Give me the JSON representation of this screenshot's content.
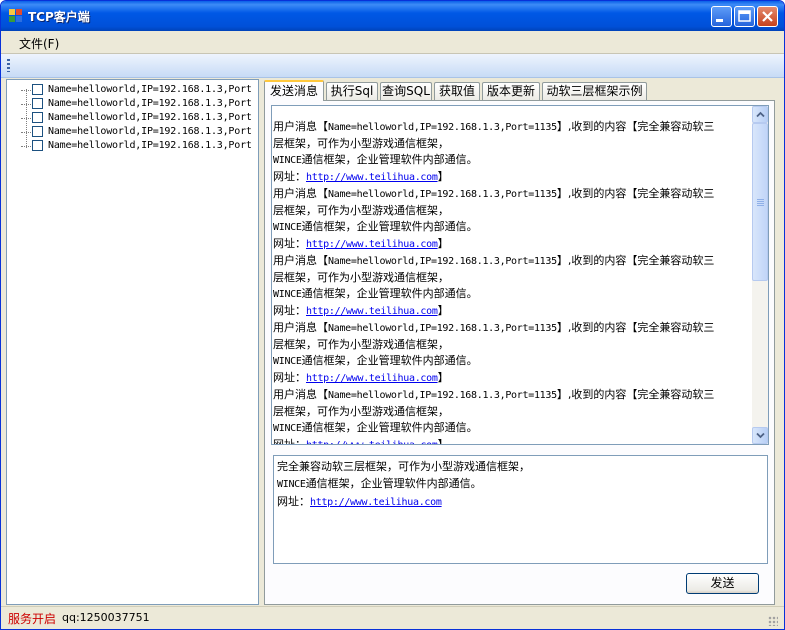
{
  "window": {
    "title": "TCP客户端"
  },
  "menu": {
    "file": "文件(F)"
  },
  "tree": {
    "items": [
      "Name=helloworld,IP=192.168.1.3,Port",
      "Name=helloworld,IP=192.168.1.3,Port",
      "Name=helloworld,IP=192.168.1.3,Port",
      "Name=helloworld,IP=192.168.1.3,Port",
      "Name=helloworld,IP=192.168.1.3,Port"
    ]
  },
  "tabs": [
    "发送消息",
    "执行Sql",
    "查询SQL",
    "获取值",
    "版本更新",
    "动软三层框架示例"
  ],
  "log": {
    "messages": [
      {
        "prefix": "用户消息【",
        "user": "Name=helloworld,IP=192.168.1.3,Port=1135",
        "mid": "】,收到的内容【完全兼容动软三",
        "line2": "层框架，可作为小型游戏通信框架，",
        "line3_mono": "WINCE",
        "line3": "通信框架，企业管理软件内部通信。",
        "url_label": "网址：",
        "url": "http://www.teilihua.com",
        "end": "】"
      },
      {
        "prefix": "用户消息【",
        "user": "Name=helloworld,IP=192.168.1.3,Port=1135",
        "mid": "】,收到的内容【完全兼容动软三",
        "line2": "层框架，可作为小型游戏通信框架，",
        "line3_mono": "WINCE",
        "line3": "通信框架，企业管理软件内部通信。",
        "url_label": "网址：",
        "url": "http://www.teilihua.com",
        "end": "】"
      },
      {
        "prefix": "用户消息【",
        "user": "Name=helloworld,IP=192.168.1.3,Port=1135",
        "mid": "】,收到的内容【完全兼容动软三",
        "line2": "层框架，可作为小型游戏通信框架，",
        "line3_mono": "WINCE",
        "line3": "通信框架，企业管理软件内部通信。",
        "url_label": "网址：",
        "url": "http://www.teilihua.com",
        "end": "】"
      },
      {
        "prefix": "用户消息【",
        "user": "Name=helloworld,IP=192.168.1.3,Port=1135",
        "mid": "】,收到的内容【完全兼容动软三",
        "line2": "层框架，可作为小型游戏通信框架，",
        "line3_mono": "WINCE",
        "line3": "通信框架，企业管理软件内部通信。",
        "url_label": "网址：",
        "url": "http://www.teilihua.com",
        "end": "】"
      },
      {
        "prefix": "用户消息【",
        "user": "Name=helloworld,IP=192.168.1.3,Port=1135",
        "mid": "】,收到的内容【完全兼容动软三",
        "line2": "层框架，可作为小型游戏通信框架，",
        "line3_mono": "WINCE",
        "line3": "通信框架，企业管理软件内部通信。",
        "url_label": "网址：",
        "url": "http://www.teilihua.com",
        "end": "】"
      }
    ]
  },
  "compose": {
    "line1": "完全兼容动软三层框架，可作为小型游戏通信框架，",
    "line2_mono": "WINCE",
    "line2": "通信框架，企业管理软件内部通信。",
    "url_label": "网址：",
    "url": "http://www.teilihua.com"
  },
  "send_button": "发送",
  "status": {
    "service": "服务开启",
    "qq": "qq:1250037751"
  },
  "colors": {
    "titlebar": "#0054e3",
    "status_service": "#cc0000",
    "link": "#0000ee",
    "tab_active_accent": "#ffc83c"
  }
}
